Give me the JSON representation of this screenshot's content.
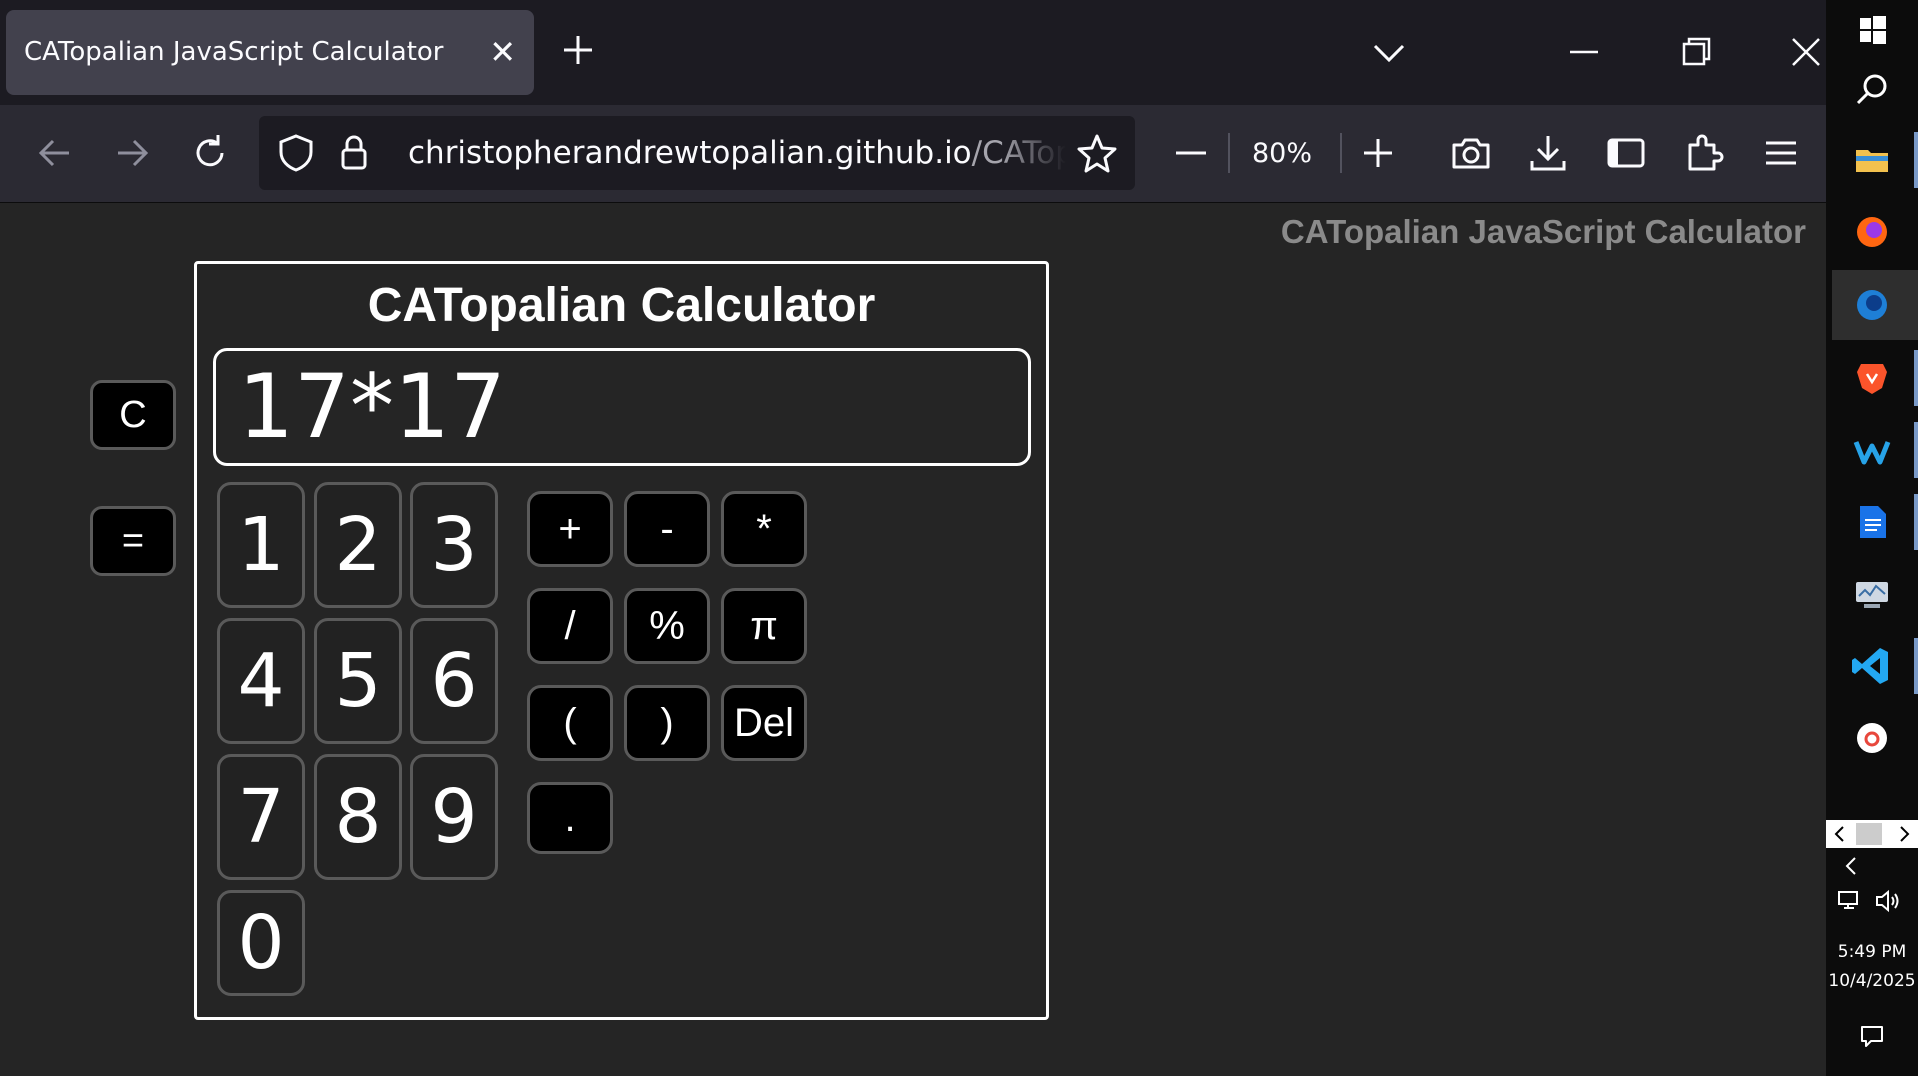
{
  "browser": {
    "tab": {
      "title": "CATopalian JavaScript Calculator",
      "close_label": "✕"
    },
    "url": {
      "main": "christopherandrewtopalian.github.io",
      "rest": "/CATopalian"
    },
    "zoom": "80%"
  },
  "page": {
    "heading": "CATopalian JavaScript Calculator",
    "calc_title": "CATopalian Calculator",
    "display_value": "17*17",
    "clear_label": "C",
    "equals_label": "=",
    "digits": [
      "1",
      "2",
      "3",
      "4",
      "5",
      "6",
      "7",
      "8",
      "9",
      "0"
    ],
    "ops": [
      "+",
      "-",
      "*",
      "/",
      "%",
      "π",
      "(",
      ")",
      "Del",
      "."
    ]
  },
  "taskbar": {
    "time": "5:49 PM",
    "date": "10/4/2025"
  }
}
